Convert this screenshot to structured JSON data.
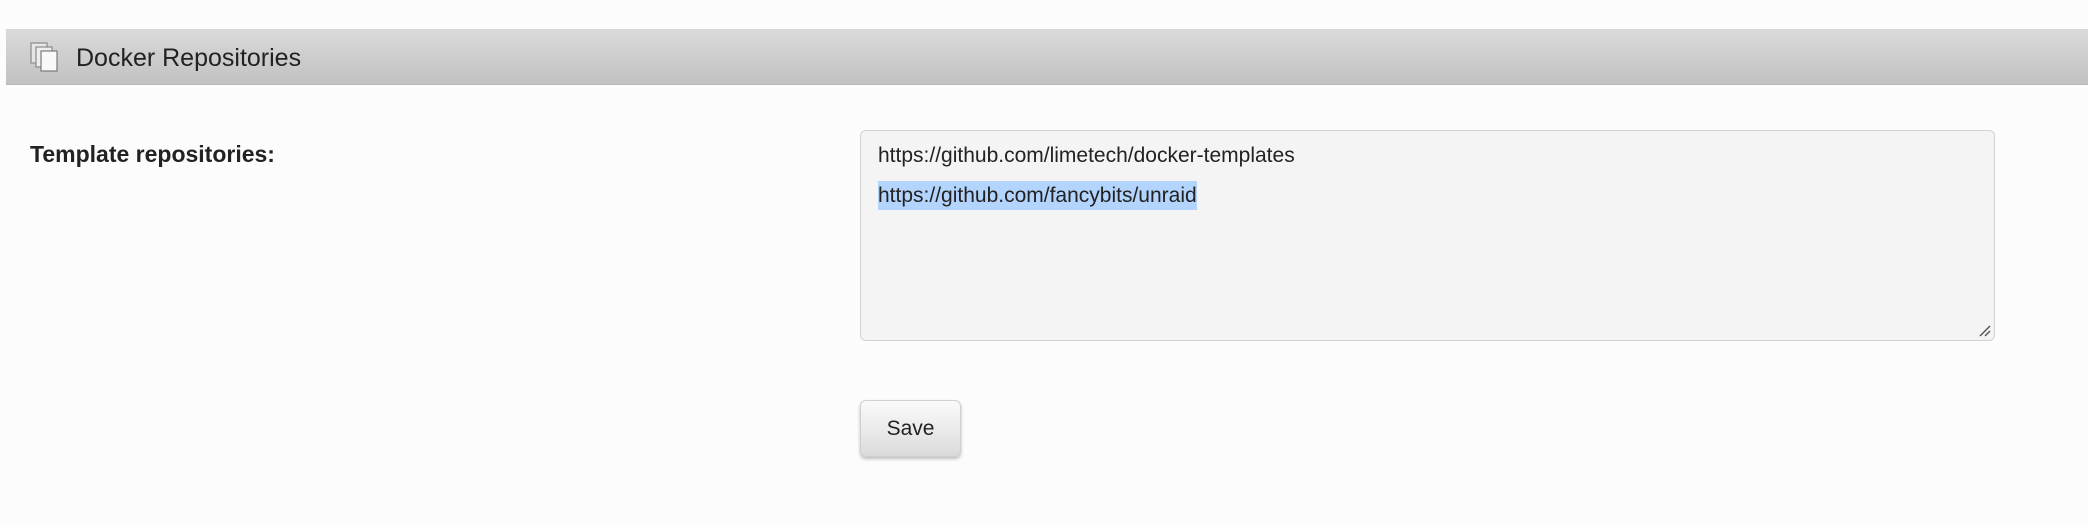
{
  "header": {
    "title": "Docker Repositories",
    "icon": "pages-icon"
  },
  "form": {
    "template_repositories_label": "Template repositories:",
    "repositories": [
      "https://github.com/limetech/docker-templates",
      "https://github.com/fancybits/unraid"
    ],
    "selected_repository_index": 1,
    "save_label": "Save"
  },
  "colors": {
    "header_bar": "#cccccc",
    "textarea_background": "#f4f4f4",
    "selection_highlight": "#b3d4fd"
  }
}
